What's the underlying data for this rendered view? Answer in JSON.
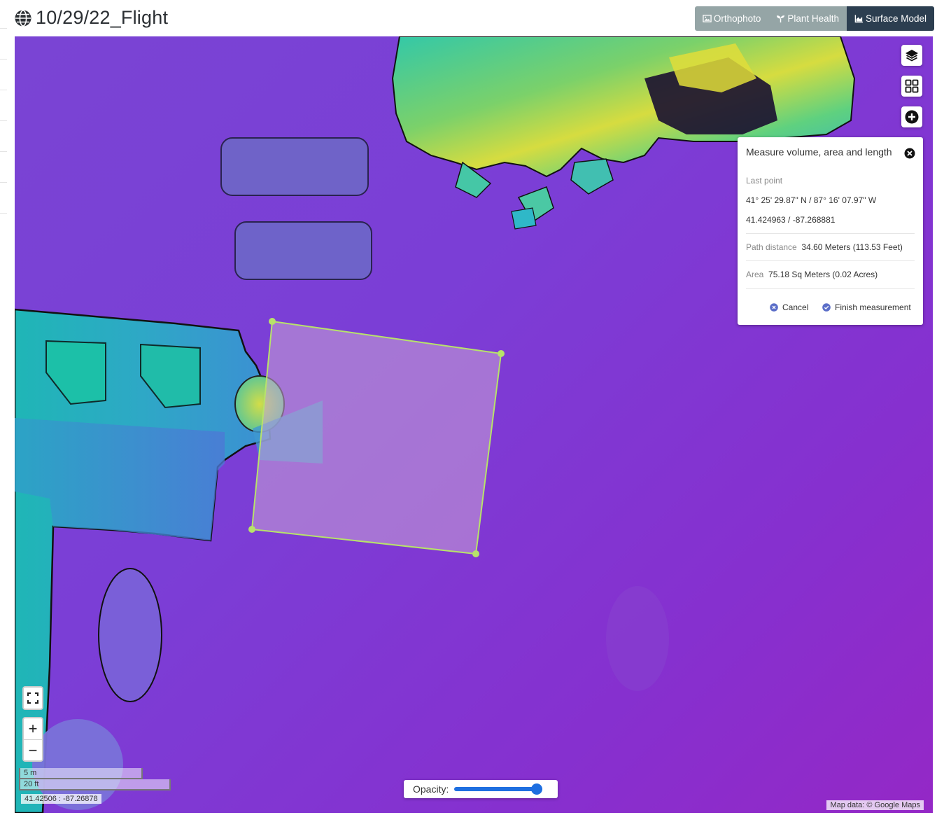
{
  "header": {
    "title": "10/29/22_Flight",
    "title_icon": "globe-icon",
    "tabs": [
      {
        "label": "Orthophoto",
        "icon": "image-icon",
        "active": false
      },
      {
        "label": "Plant Health",
        "icon": "seedling-icon",
        "active": false
      },
      {
        "label": "Surface Model",
        "icon": "chart-area-icon",
        "active": true
      }
    ]
  },
  "map_controls": {
    "layers_icon": "layers-icon",
    "grid_icon": "grid-icon",
    "add_icon": "plus-circle-icon",
    "fullscreen_icon": "fullscreen-icon",
    "zoom_in": "+",
    "zoom_out": "−"
  },
  "measure_panel": {
    "title": "Measure volume, area and length",
    "last_point_label": "Last point",
    "last_point_dms": "41° 25' 29.87\" N / 87° 16' 07.97\" W",
    "last_point_decimal": "41.424963 / -87.268881",
    "path_distance_label": "Path distance",
    "path_distance_value": "34.60 Meters (113.53 Feet)",
    "area_label": "Area",
    "area_value": "75.18 Sq Meters (0.02 Acres)",
    "cancel_label": "Cancel",
    "finish_label": "Finish measurement"
  },
  "scale": {
    "metric": "5 m",
    "imperial": "20 ft"
  },
  "cursor_coords": "41.42506 : -87.26878",
  "opacity": {
    "label": "Opacity:",
    "value": 1.0
  },
  "attribution": "Map data: © Google Maps",
  "colors": {
    "accent": "#2c3e50",
    "tab_inactive": "#95a5a6",
    "measure_line": "#b7e36a",
    "slider": "#1e6fe0",
    "map_base": "#7b3ed6"
  }
}
